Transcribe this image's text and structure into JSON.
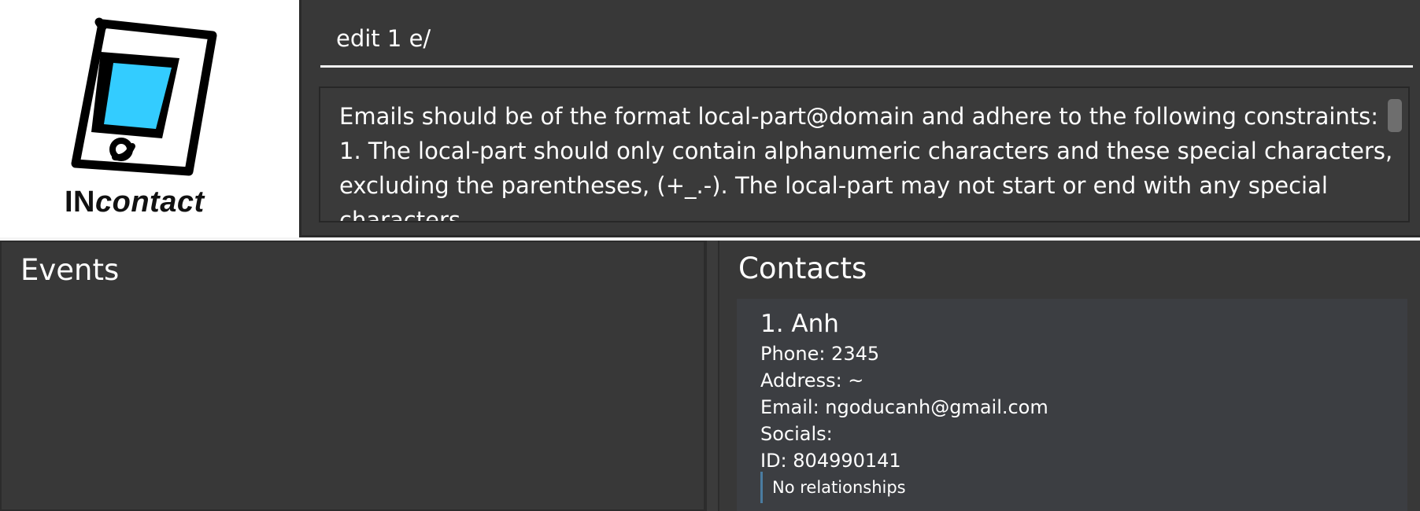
{
  "logo": {
    "brand_prefix": "IN",
    "brand_suffix": "contact",
    "icon": "handheld-device-icon",
    "screen_color": "#33ccff"
  },
  "command": {
    "input_value": "edit 1 e/"
  },
  "result": {
    "message": "Emails should be of the format local-part@domain and adhere to the following constraints:\n1. The local-part should only contain alphanumeric characters and these special characters, excluding the parentheses, (+_.-). The local-part may not start or end with any special characters."
  },
  "events": {
    "title": "Events"
  },
  "contacts": {
    "title": "Contacts",
    "items": [
      {
        "name": "1. Anh",
        "phone": "Phone: 2345",
        "address": "Address: ~",
        "email": "Email: ngoducanh@gmail.com",
        "socials": "Socials:",
        "id": "ID: 804990141",
        "relationships": "No relationships"
      }
    ]
  },
  "colors": {
    "background": "#383838",
    "accent": "#4a7ca0"
  }
}
